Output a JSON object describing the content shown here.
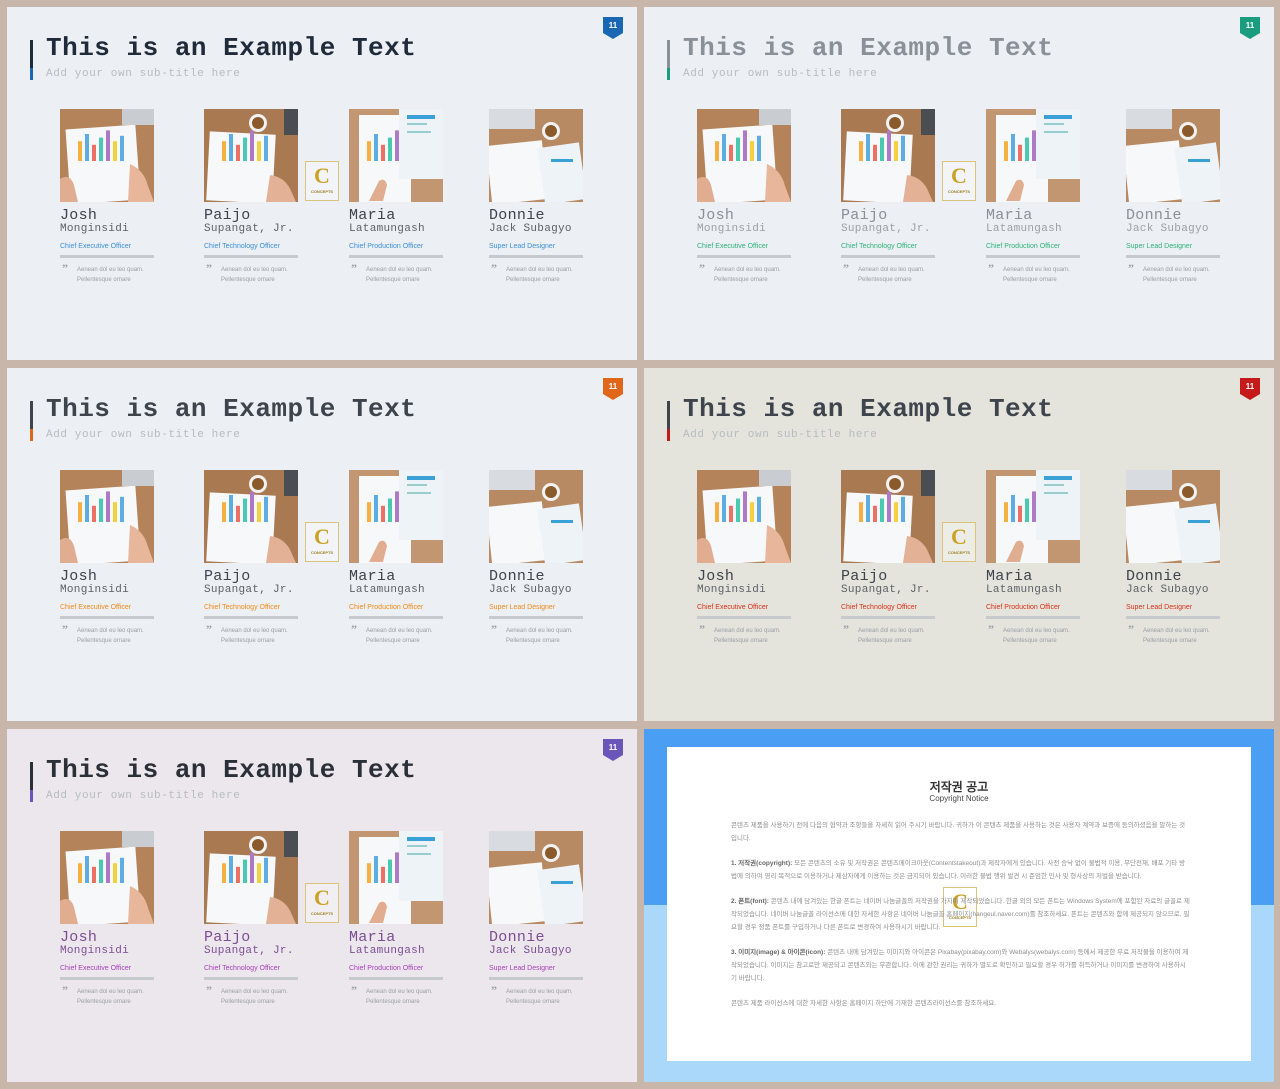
{
  "slides": [
    {
      "id": "blue",
      "title": "This is an Example Text",
      "subtitle": "Add your own sub-title here",
      "page_number": "11",
      "accent": "#1a68b3",
      "title_color": "#1f2b3a",
      "bg": "#eceff3",
      "name_color": "#3e444c",
      "last_color": "#5c6168"
    },
    {
      "id": "green",
      "title": "This is an Example Text",
      "subtitle": "Add your own sub-title here",
      "page_number": "11",
      "accent": "#1a9d7f",
      "title_color": "#8a9098",
      "bg": "#eceff3",
      "name_color": "#8a9098",
      "last_color": "#9aa0a6"
    },
    {
      "id": "orange",
      "title": "This is an Example Text",
      "subtitle": "Add your own sub-title here",
      "page_number": "11",
      "accent": "#e0661a",
      "title_color": "#3e444c",
      "bg": "#eceff3",
      "name_color": "#3e444c",
      "last_color": "#5c6168"
    },
    {
      "id": "red",
      "title": "This is an Example Text",
      "subtitle": "Add your own sub-title here",
      "page_number": "11",
      "accent": "#c41a1a",
      "title_color": "#3e444c",
      "bg": "#e4e3dc",
      "name_color": "#3e444c",
      "last_color": "#5c6168"
    },
    {
      "id": "purple",
      "title": "This is an Example Text",
      "subtitle": "Add your own sub-title here",
      "page_number": "11",
      "accent": "#6a56b8",
      "title_color": "#2b2f38",
      "bg": "#ebe7ec",
      "name_color": "#7d4d93",
      "last_color": "#7d4d93"
    }
  ],
  "role_colors": {
    "blue": "#3b8fd9",
    "green": "#2db37a",
    "orange": "#ef8a1a",
    "red": "#d9321a",
    "purple": "#a640b8"
  },
  "team": [
    {
      "first": "Josh",
      "last": "Monginsidi",
      "role": "Chief Executive Officer",
      "quote_line1": "Aenean dol eu leo quam.",
      "quote_line2": "Pellentesque ornare"
    },
    {
      "first": "Paijo",
      "last": "Supangat, Jr.",
      "role": "Chief Technology Officer",
      "quote_line1": "Aenean dol eu leo quam.",
      "quote_line2": "Pellentesque ornare"
    },
    {
      "first": "Maria",
      "last": "Latamungash",
      "role": "Chief Production Officer",
      "quote_line1": "Aenean dol eu leo quam.",
      "quote_line2": "Pellentesque ornare"
    },
    {
      "first": "Donnie",
      "last": "Jack Subagyo",
      "role": "Super Lead Designer",
      "quote_line1": "Aenean dol eu leo quam.",
      "quote_line2": "Pellentesque ornare"
    }
  ],
  "logo": {
    "letter": "C",
    "text": "CONCEPTS"
  },
  "notice": {
    "title": "저작권 공고",
    "subtitle": "Copyright Notice",
    "intro": "콘텐츠 제품을 사용하기 전에 다음의 협약과 조항들을 자세히 읽어 주시기 바랍니다. 귀하가 이 콘텐츠 제품을 사용하는 것은 사용자 계약과 보증에 동의하셨음을 말하는 것입니다.",
    "item1_head": "1. 저작권(copyright):",
    "item1_body": "모든 콘텐츠의 소유 및 저작권은 콘텐츠메이크아웃(Contentstakeout)과 제작자에게 있습니다. 사전 승낙 없이 불법적 이용, 무단전재, 배포 기타 방법에 의하여 영리 목적으로 이용하거나 제삼자에게 이용하는 것은 금지되어 있습니다. 이러한 불법 행위 발견 시 준엄한 민사 및 형사상의 처벌을 받습니다.",
    "item2_head": "2. 폰트(font):",
    "item2_body": "콘텐츠 내에 담겨있는 한글 폰트는 네이버 나눔글꼴의 저작권을 가지며 제작되었습니다. 한글 외의 모든 폰트는 Windows System에 포함된 자료의 글꼴로 제작되었습니다. 네이버 나눔글꼴 라이선스에 대한 자세한 사항은 네이버 나눔글꼴 홈페이지(hangeul.naver.com)를 참조하세요. 폰트는 콘텐츠와 함께 제공되지 않으므로, 필요할 경우 정품 폰트를 구입하거나 다른 폰트로 변경하여 사용하시기 바랍니다.",
    "item3_head": "3. 이미지(image) & 아이콘(icon):",
    "item3_body": "콘텐츠 내에 담겨있는 이미지와 아이콘은 Pixabay(pixabay.com)와 Webalys(webalys.com) 등에서 제공한 무료 저작물을 이용하여 제작되었습니다. 이미지는 참고로만 제공되고 콘텐츠와는 무관합니다. 이에 관한 권리는 귀하가 별도로 확인하고 필요할 경우 허가를 취득하거나 이미지를 변경하여 사용하시기 바랍니다.",
    "footer": "콘텐츠 제품 라이선스에 대한 자세한 사항은 홈페이지 하단에 기재한 콘텐츠라이선스를 참조하세요."
  }
}
